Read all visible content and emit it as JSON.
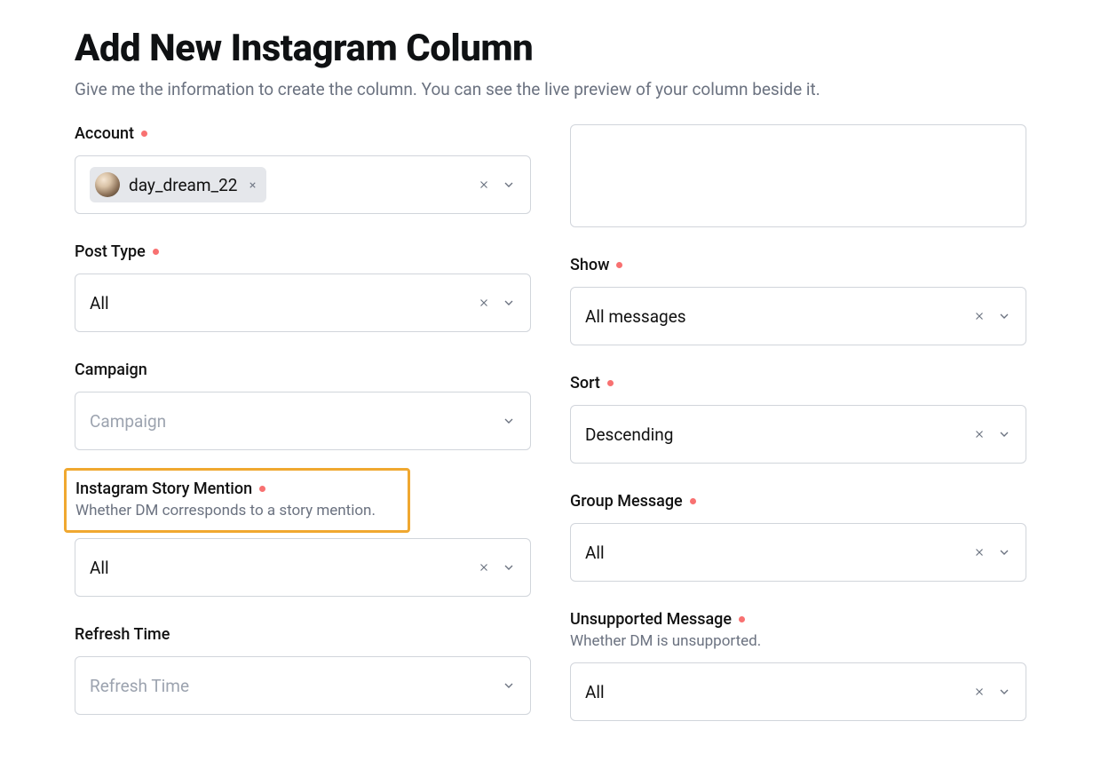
{
  "header": {
    "title": "Add New Instagram Column",
    "subtitle": "Give me the information to create the column. You can see the live preview of your column beside it."
  },
  "left": {
    "account": {
      "label": "Account",
      "chip": "day_dream_22"
    },
    "post_type": {
      "label": "Post Type",
      "value": "All"
    },
    "campaign": {
      "label": "Campaign",
      "placeholder": "Campaign"
    },
    "story_mention": {
      "label": "Instagram Story Mention",
      "sublabel": "Whether DM corresponds to a story mention.",
      "value": "All"
    },
    "refresh_time": {
      "label": "Refresh Time",
      "placeholder": "Refresh Time"
    }
  },
  "right": {
    "show": {
      "label": "Show",
      "value": "All messages"
    },
    "sort": {
      "label": "Sort",
      "value": "Descending"
    },
    "group_message": {
      "label": "Group Message",
      "value": "All"
    },
    "unsupported": {
      "label": "Unsupported Message",
      "sublabel": "Whether DM is unsupported.",
      "value": "All"
    }
  }
}
